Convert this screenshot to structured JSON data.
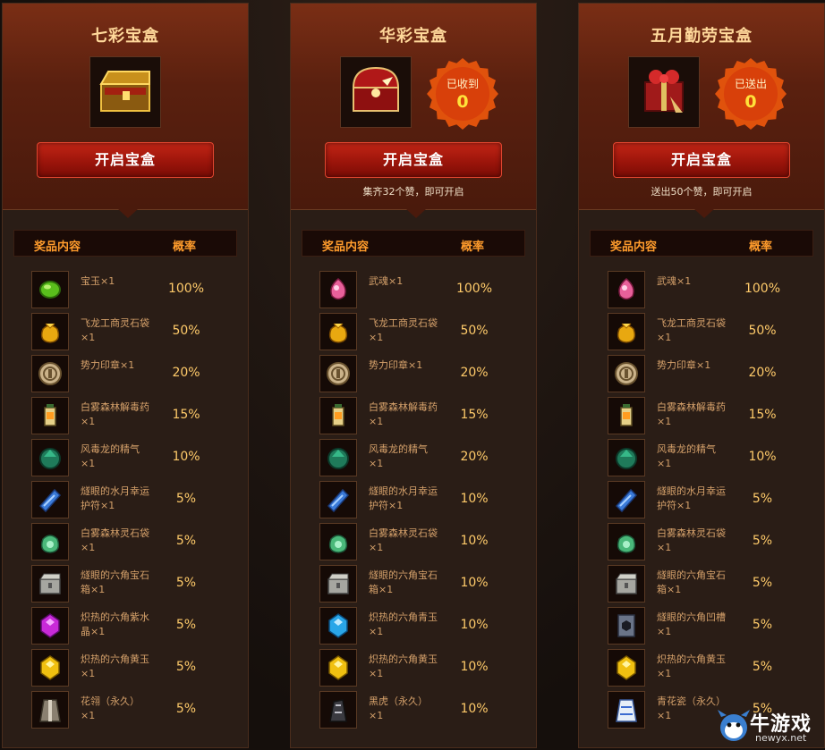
{
  "watermark": {
    "brand": "牛游戏",
    "url": "newyx.net"
  },
  "boxes": [
    {
      "title": "七彩宝盒",
      "open_label": "开启宝盒",
      "hint": "",
      "badge": null,
      "chest_icon": "golden-chest-icon",
      "col_name": "奖品内容",
      "col_rate": "概率",
      "items": [
        {
          "name": "宝玉×1",
          "rate": "100%",
          "icon": "green-jade-icon"
        },
        {
          "name": "飞龙工商灵石袋×1",
          "rate": "50%",
          "icon": "gold-pouch-icon"
        },
        {
          "name": "势力印章×1",
          "rate": "20%",
          "icon": "seal-icon"
        },
        {
          "name": "白雾森林解毒药×1",
          "rate": "15%",
          "icon": "lantern-potion-icon"
        },
        {
          "name": "风毒龙的精气×1",
          "rate": "10%",
          "icon": "dragon-essence-icon"
        },
        {
          "name": "燧眼的水月幸运护符×1",
          "rate": "5%",
          "icon": "blue-charm-icon"
        },
        {
          "name": "白雾森林灵石袋×1",
          "rate": "5%",
          "icon": "green-pouch-icon"
        },
        {
          "name": "燧眼的六角宝石箱×1",
          "rate": "5%",
          "icon": "gem-box-icon"
        },
        {
          "name": "炽热的六角紫水晶×1",
          "rate": "5%",
          "icon": "purple-crystal-icon"
        },
        {
          "name": "炽热的六角黄玉×1",
          "rate": "5%",
          "icon": "yellow-topaz-icon"
        },
        {
          "name": "花翎（永久）×1",
          "rate": "5%",
          "icon": "outfit-icon"
        }
      ]
    },
    {
      "title": "华彩宝盒",
      "open_label": "开启宝盒",
      "hint": "集齐32个赞，即可开启",
      "badge": {
        "label": "已收到",
        "count": "0"
      },
      "chest_icon": "red-chest-icon",
      "col_name": "奖品内容",
      "col_rate": "概率",
      "items": [
        {
          "name": "武魂×1",
          "rate": "100%",
          "icon": "pink-soul-icon"
        },
        {
          "name": "飞龙工商灵石袋×1",
          "rate": "50%",
          "icon": "gold-pouch-icon"
        },
        {
          "name": "势力印章×1",
          "rate": "20%",
          "icon": "seal-icon"
        },
        {
          "name": "白雾森林解毒药×1",
          "rate": "15%",
          "icon": "lantern-potion-icon"
        },
        {
          "name": "风毒龙的精气×1",
          "rate": "20%",
          "icon": "dragon-essence-icon"
        },
        {
          "name": "燧眼的水月幸运护符×1",
          "rate": "10%",
          "icon": "blue-charm-icon"
        },
        {
          "name": "白雾森林灵石袋×1",
          "rate": "10%",
          "icon": "green-pouch-icon"
        },
        {
          "name": "燧眼的六角宝石箱×1",
          "rate": "10%",
          "icon": "gem-box-icon"
        },
        {
          "name": "炽热的六角青玉×1",
          "rate": "10%",
          "icon": "blue-sapphire-icon"
        },
        {
          "name": "炽热的六角黄玉×1",
          "rate": "10%",
          "icon": "yellow-topaz-icon"
        },
        {
          "name": "黑虎（永久）×1",
          "rate": "10%",
          "icon": "black-tiger-icon"
        }
      ]
    },
    {
      "title": "五月勤劳宝盒",
      "open_label": "开启宝盒",
      "hint": "送出50个赞，即可开启",
      "badge": {
        "label": "已送出",
        "count": "0"
      },
      "chest_icon": "gift-box-icon",
      "col_name": "奖品内容",
      "col_rate": "概率",
      "items": [
        {
          "name": "武魂×1",
          "rate": "100%",
          "icon": "pink-soul-icon"
        },
        {
          "name": "飞龙工商灵石袋×1",
          "rate": "50%",
          "icon": "gold-pouch-icon"
        },
        {
          "name": "势力印章×1",
          "rate": "20%",
          "icon": "seal-icon"
        },
        {
          "name": "白雾森林解毒药×1",
          "rate": "15%",
          "icon": "lantern-potion-icon"
        },
        {
          "name": "风毒龙的精气×1",
          "rate": "10%",
          "icon": "dragon-essence-icon"
        },
        {
          "name": "燧眼的水月幸运护符×1",
          "rate": "5%",
          "icon": "blue-charm-icon"
        },
        {
          "name": "白雾森林灵石袋×1",
          "rate": "5%",
          "icon": "green-pouch-icon"
        },
        {
          "name": "燧眼的六角宝石箱×1",
          "rate": "5%",
          "icon": "gem-box-icon"
        },
        {
          "name": "燧眼的六角凹槽×1",
          "rate": "5%",
          "icon": "socket-icon"
        },
        {
          "name": "炽热的六角黄玉×1",
          "rate": "5%",
          "icon": "yellow-topaz-icon"
        },
        {
          "name": "青花瓷（永久）×1",
          "rate": "5%",
          "icon": "porcelain-outfit-icon"
        }
      ]
    }
  ]
}
